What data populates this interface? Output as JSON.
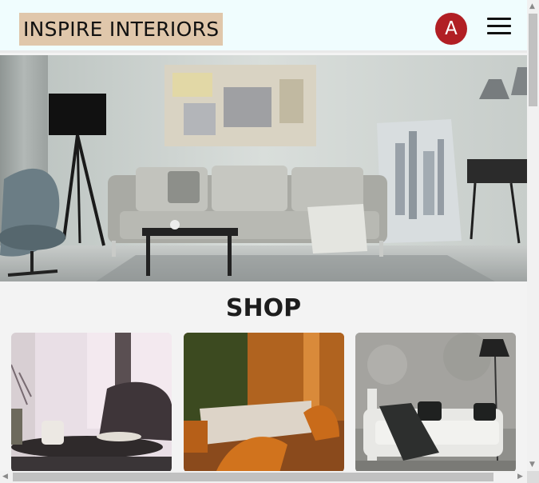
{
  "header": {
    "brand": "INSPIRE INTERIORS",
    "avatar_initial": "A"
  },
  "shop": {
    "title": "SHOP"
  },
  "colors": {
    "header_bg": "#f0fdfe",
    "brand_bg": "#e0c7ab",
    "avatar_bg": "#b11f24",
    "page_bg": "#f3f3f3"
  },
  "icons": [
    "menu-icon",
    "scroll-up-arrow-icon",
    "scroll-down-arrow-icon",
    "scroll-left-arrow-icon",
    "scroll-right-arrow-icon"
  ]
}
